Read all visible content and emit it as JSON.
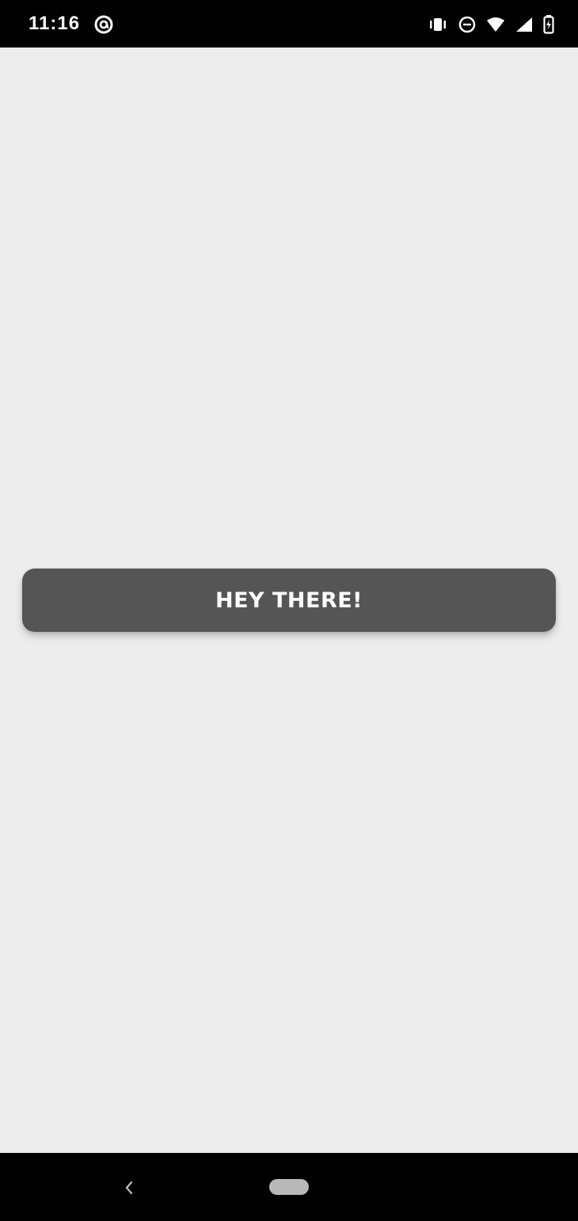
{
  "status_bar": {
    "time": "11:16",
    "left_icons": [
      "at-sign-icon"
    ],
    "right_icons": [
      "vibrate-icon",
      "do-not-disturb-icon",
      "wifi-icon",
      "cellular-signal-icon",
      "battery-charging-icon"
    ]
  },
  "main": {
    "button_label": "HEY THERE!"
  },
  "navigation": {
    "items": [
      "back-icon",
      "home-pill"
    ]
  },
  "colors": {
    "background": "#ededed",
    "button": "#555555",
    "button_text": "#ffffff",
    "system_bars": "#000000"
  }
}
